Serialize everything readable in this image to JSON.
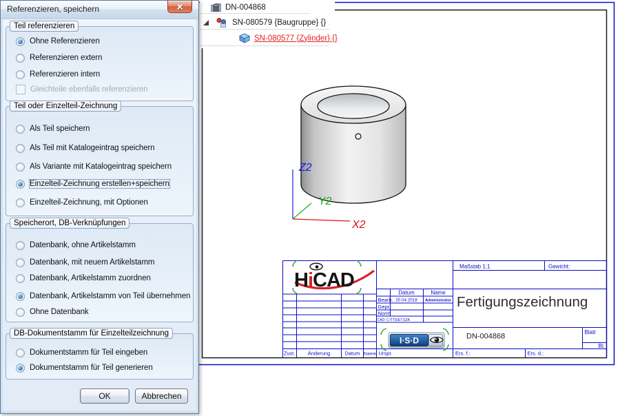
{
  "dialog": {
    "title": "Referenzieren, speichern",
    "icons": {
      "close": "✕"
    },
    "groups": [
      {
        "label": "Teil referenzieren",
        "options": [
          {
            "label": "Ohne Referenzieren",
            "selected": true
          },
          {
            "label": "Referenzieren extern",
            "selected": false
          },
          {
            "label": "Referenzieren intern",
            "selected": false
          }
        ],
        "checkbox": {
          "label": "Gleichteile ebenfalls referenzieren",
          "checked": false,
          "disabled": true
        }
      },
      {
        "label": "Teil oder Einzelteil-Zeichnung",
        "options": [
          {
            "label": "Als Teil speichern",
            "selected": false
          },
          {
            "label": "Als Teil mit Katalogeintrag speichern",
            "selected": false
          },
          {
            "label": "Als Variante mit Katalogeintrag speichern",
            "selected": false
          },
          {
            "label": "Einzelteil-Zeichnung erstellen+speichern",
            "selected": true,
            "focused": true
          },
          {
            "label": "Einzelteil-Zeichnung, mit Optionen",
            "selected": false
          }
        ]
      },
      {
        "label": "Speicherort, DB-Verknüpfungen",
        "options": [
          {
            "label": "Datenbank, ohne Artikelstamm",
            "selected": false
          },
          {
            "label": "Datenbank, mit neuem Artikelstamm",
            "selected": false
          },
          {
            "label": "Datenbank, Artikelstamm zuordnen",
            "selected": false
          },
          {
            "label": "Datenbank, Artikelstamm von Teil übernehmen",
            "selected": true
          },
          {
            "label": "Ohne Datenbank",
            "selected": false
          }
        ]
      },
      {
        "label": "DB-Dokumentstamm für Einzelteilzeichnung",
        "options": [
          {
            "label": "Dokumentstamm für Teil eingeben",
            "selected": false
          },
          {
            "label": "Dokumentstamm für Teil generieren",
            "selected": true
          }
        ]
      }
    ],
    "buttons": {
      "ok": "OK",
      "cancel": "Abbrechen"
    }
  },
  "tree": {
    "items": [
      {
        "label": "DN-004868",
        "icon": "drawing-document-icon",
        "selected": false
      },
      {
        "label": "SN-080579 {Baugruppe} {}",
        "icon": "assembly-icon",
        "expanded": true,
        "selected": false
      },
      {
        "label": "SN-080577 {Zylinder} {}",
        "icon": "part-cube-icon",
        "selected": true
      }
    ]
  },
  "viewport": {
    "axis_labels": {
      "x": "X2",
      "y": "Y2",
      "z": "Z2"
    },
    "axis_colors": {
      "x": "#e01010",
      "y": "#12b212",
      "z": "#1a1aee"
    }
  },
  "title_block": {
    "hicad_logo": {
      "h": "H",
      "i": "i",
      "cad": "CAD"
    },
    "scale": "Maßstab 1:1",
    "weight": "Gewicht:",
    "col_datum": "Datum",
    "col_name": "Name",
    "bearb_label": "Bearb.",
    "bearb_datum": "20.04.2018",
    "bearb_name": "Administrator",
    "gepr_label": "Gepr.",
    "norm_label": "Norm",
    "cad_path": "CAD:  C:\\TTE\\ET.SZA",
    "isd_text": "I·S·D",
    "drawing_title": "Fertigungszeichnung",
    "doc_number": "DN-004868",
    "blatt": "Blatt",
    "bl": "Bl.",
    "zust": "Zust.",
    "aenderung": "Änderung",
    "datum": "Datum",
    "name": "Name",
    "urspr": "Urspr.",
    "ers_f": "Ers. f.:",
    "ers_d": "Ers. d.:"
  }
}
